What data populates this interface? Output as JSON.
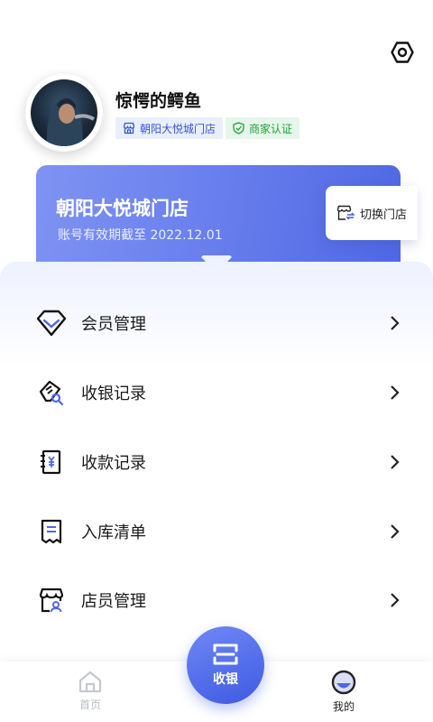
{
  "colors": {
    "accent": "#4f67e3",
    "store_tag_text": "#3556d8",
    "cert_tag_text": "#20a03c",
    "inactive_tab": "#b8bcc4",
    "active_tab": "#222222"
  },
  "header": {
    "settings_icon": "settings-hexagon-icon"
  },
  "profile": {
    "username": "惊愕的鳄鱼",
    "store_tag": "朝阳大悦城门店",
    "cert_tag": "商家认证"
  },
  "store_card": {
    "store_name": "朝阳大悦城门店",
    "expire_text": "账号有效期截至 2022.12.01",
    "switch_label": "切换门店"
  },
  "menu": {
    "items": [
      {
        "label": "会员管理",
        "icon": "diamond-icon"
      },
      {
        "label": "收银记录",
        "icon": "receipt-search-icon"
      },
      {
        "label": "收款记录",
        "icon": "yen-ledger-icon"
      },
      {
        "label": "入库清单",
        "icon": "inventory-list-icon"
      },
      {
        "label": "店员管理",
        "icon": "staff-store-icon"
      }
    ]
  },
  "tabbar": {
    "home_label": "首页",
    "cashier_label": "收银",
    "mine_label": "我的",
    "active_tab": "我的"
  }
}
